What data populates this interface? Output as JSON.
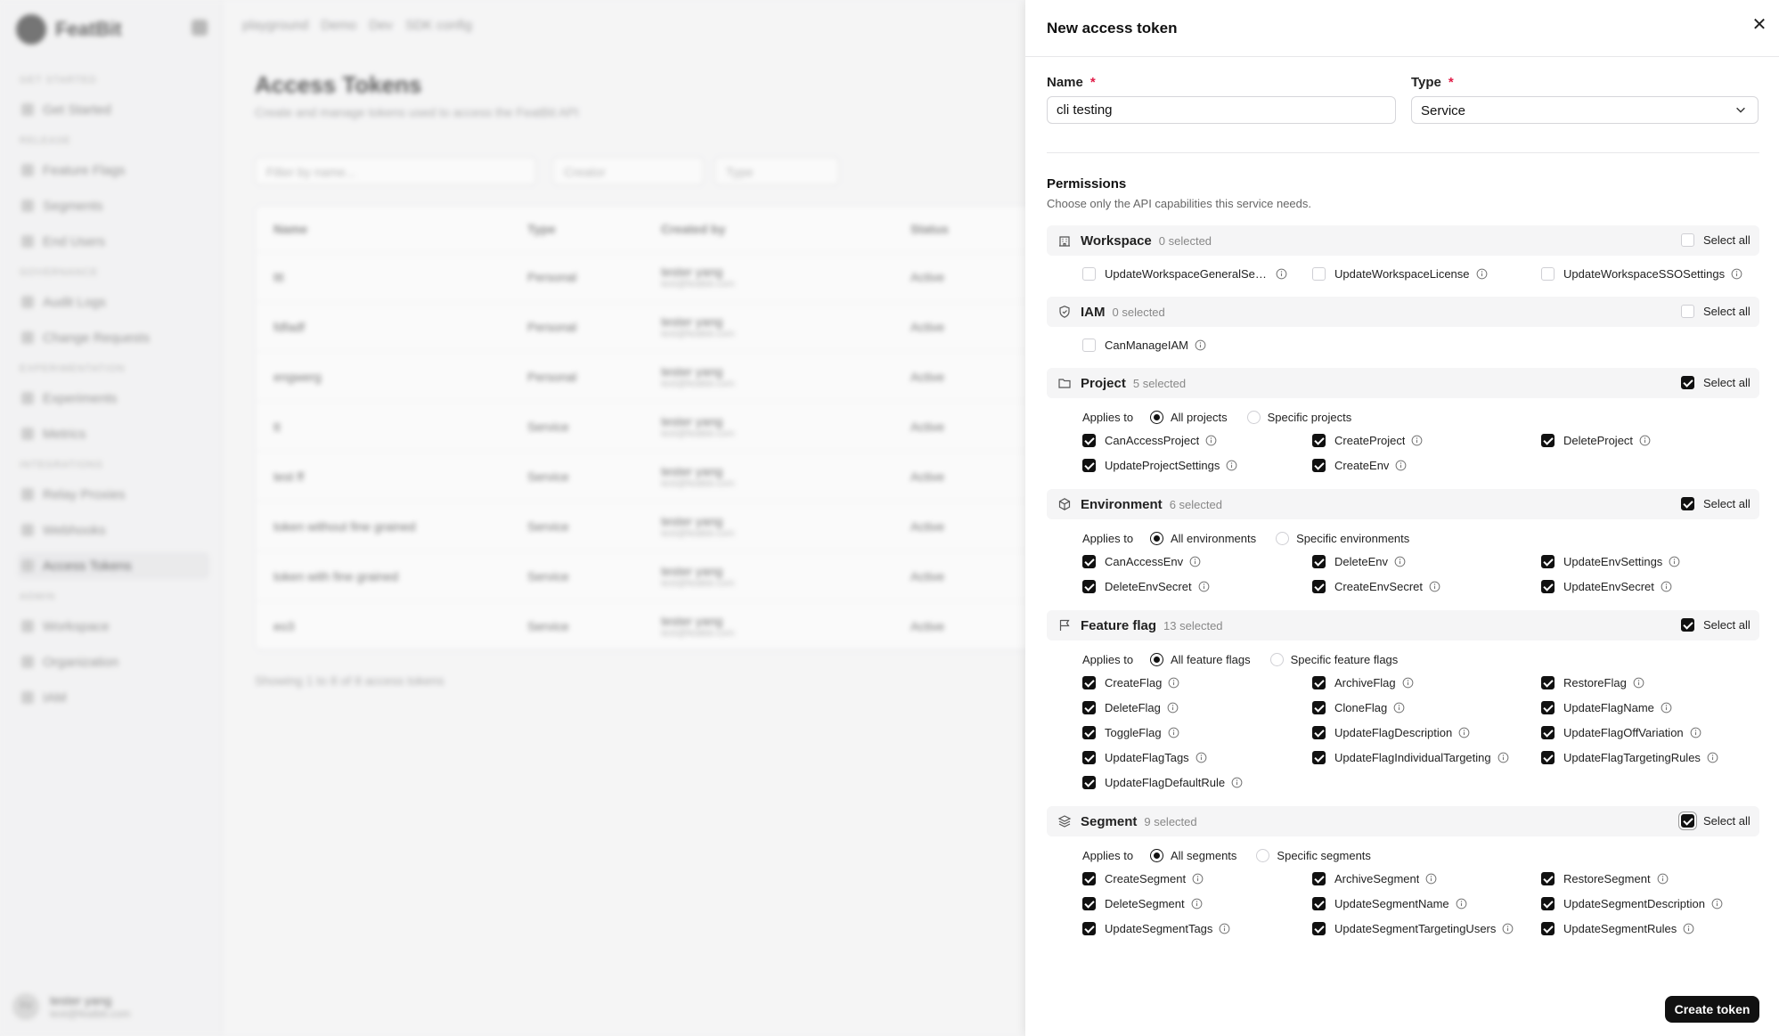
{
  "background": {
    "brand": "FeatBit",
    "nav_sections": [
      {
        "title": "GET STARTED",
        "items": [
          "Get Started"
        ]
      },
      {
        "title": "RELEASE",
        "items": [
          "Feature Flags",
          "Segments",
          "End Users"
        ]
      },
      {
        "title": "GOVERNANCE",
        "items": [
          "Audit Logs",
          "Change Requests"
        ]
      },
      {
        "title": "EXPERIMENTATION",
        "items": [
          "Experiments",
          "Metrics"
        ]
      },
      {
        "title": "INTEGRATIONS",
        "items": [
          "Relay Proxies",
          "Webhooks",
          "Access Tokens"
        ]
      },
      {
        "title": "ADMIN",
        "items": [
          "Workspace",
          "Organization",
          "IAM"
        ]
      }
    ],
    "active_nav": "Access Tokens",
    "breadcrumb": [
      "playground",
      "Demo",
      "Dev",
      "SDK config"
    ],
    "page_title": "Access Tokens",
    "page_subtitle": "Create and manage tokens used to access the FeatBit API",
    "filter_placeholder": "Filter by name...",
    "filter_creator": "Creator",
    "filter_type": "Type",
    "table_headers": [
      "Name",
      "Type",
      "Created by",
      "Status"
    ],
    "table_rows": [
      {
        "name": "ttt",
        "type": "Personal",
        "by": "tester yang",
        "email": "test@featbit.com",
        "status": "Active"
      },
      {
        "name": "fdfadf",
        "type": "Personal",
        "by": "tester yang",
        "email": "test@featbit.com",
        "status": "Active"
      },
      {
        "name": "engwerg",
        "type": "Personal",
        "by": "tester yang",
        "email": "test@featbit.com",
        "status": "Active"
      },
      {
        "name": "tt",
        "type": "Service",
        "by": "tester yang",
        "email": "test@featbit.com",
        "status": "Active"
      },
      {
        "name": "test ff",
        "type": "Service",
        "by": "tester yang",
        "email": "test@featbit.com",
        "status": "Active"
      },
      {
        "name": "token without fine grained",
        "type": "Service",
        "by": "tester yang",
        "email": "test@featbit.com",
        "status": "Active"
      },
      {
        "name": "token with fine grained",
        "type": "Service",
        "by": "tester yang",
        "email": "test@featbit.com",
        "status": "Active"
      },
      {
        "name": "eo3",
        "type": "Service",
        "by": "tester yang",
        "email": "test@featbit.com",
        "status": "Active"
      }
    ],
    "table_footer": "Showing 1 to 8 of 8 access tokens",
    "user_initials": "TY",
    "user_name": "tester yang",
    "user_email": "test@featbit.com"
  },
  "drawer": {
    "title": "New access token",
    "name_label": "Name",
    "name_value": "cli testing",
    "type_label": "Type",
    "type_value": "Service",
    "required_mark": "*",
    "permissions_title": "Permissions",
    "permissions_subtitle": "Choose only the API capabilities this service needs.",
    "select_all_label": "Select all",
    "applies_label": "Applies to",
    "create_button": "Create token",
    "groups": {
      "workspace": {
        "name": "Workspace",
        "count": "0 selected",
        "permissions": [
          "UpdateWorkspaceGeneralSetti...",
          "UpdateWorkspaceLicense",
          "UpdateWorkspaceSSOSettings"
        ]
      },
      "iam": {
        "name": "IAM",
        "count": "0 selected",
        "permissions": [
          "CanManageIAM"
        ]
      },
      "project": {
        "name": "Project",
        "count": "5 selected",
        "scope_all": "All projects",
        "scope_specific": "Specific projects",
        "permissions": [
          "CanAccessProject",
          "CreateProject",
          "DeleteProject",
          "UpdateProjectSettings",
          "CreateEnv"
        ]
      },
      "environment": {
        "name": "Environment",
        "count": "6 selected",
        "scope_all": "All environments",
        "scope_specific": "Specific environments",
        "permissions": [
          "CanAccessEnv",
          "DeleteEnv",
          "UpdateEnvSettings",
          "DeleteEnvSecret",
          "CreateEnvSecret",
          "UpdateEnvSecret"
        ]
      },
      "feature_flag": {
        "name": "Feature flag",
        "count": "13 selected",
        "scope_all": "All feature flags",
        "scope_specific": "Specific feature flags",
        "permissions": [
          "CreateFlag",
          "ArchiveFlag",
          "RestoreFlag",
          "DeleteFlag",
          "CloneFlag",
          "UpdateFlagName",
          "ToggleFlag",
          "UpdateFlagDescription",
          "UpdateFlagOffVariation",
          "UpdateFlagTags",
          "UpdateFlagIndividualTargeting",
          "UpdateFlagTargetingRules",
          "UpdateFlagDefaultRule"
        ]
      },
      "segment": {
        "name": "Segment",
        "count": "9 selected",
        "scope_all": "All segments",
        "scope_specific": "Specific segments",
        "permissions": [
          "CreateSegment",
          "ArchiveSegment",
          "RestoreSegment",
          "DeleteSegment",
          "UpdateSegmentName",
          "UpdateSegmentDescription",
          "UpdateSegmentTags",
          "UpdateSegmentTargetingUsers",
          "UpdateSegmentRules"
        ]
      }
    }
  }
}
